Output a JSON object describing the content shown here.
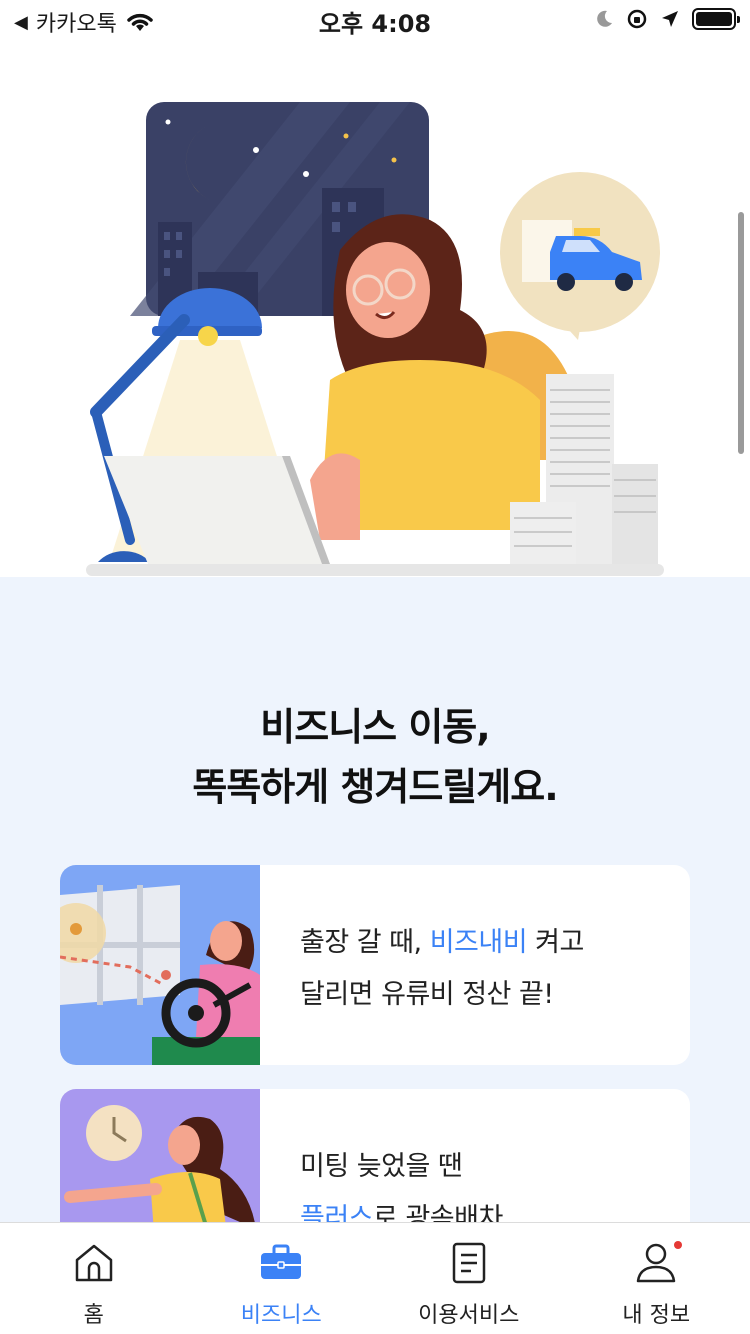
{
  "status_bar": {
    "back_app": "카카오톡",
    "time": "오후 4:08"
  },
  "hero": {
    "icons": [
      "night-window",
      "moon",
      "desk-lamp",
      "woman-working",
      "laptop",
      "paper-stack",
      "taxi-bubble"
    ]
  },
  "headline": {
    "line1": "비즈니스 이동,",
    "line2": "똑똑하게 챙겨드릴게요."
  },
  "cards": [
    {
      "line1_pre": "출장 갈 때, ",
      "line1_hl": "비즈내비",
      "line1_post": " 켜고",
      "line2": "달리면 유류비 정산 끝!"
    },
    {
      "line1": "미팅 늦었을 땐",
      "line2_hl": "플러스",
      "line2_post": "로 광속배차"
    }
  ],
  "tabs": [
    {
      "label": "홈",
      "icon": "home-icon",
      "active": false
    },
    {
      "label": "비즈니스",
      "icon": "briefcase-icon",
      "active": true
    },
    {
      "label": "이용서비스",
      "icon": "document-icon",
      "active": false
    },
    {
      "label": "내 정보",
      "icon": "person-icon",
      "active": false
    }
  ],
  "colors": {
    "accent": "#3b82f6",
    "section_bg": "#eef4fd",
    "notification_dot": "#e53935"
  }
}
